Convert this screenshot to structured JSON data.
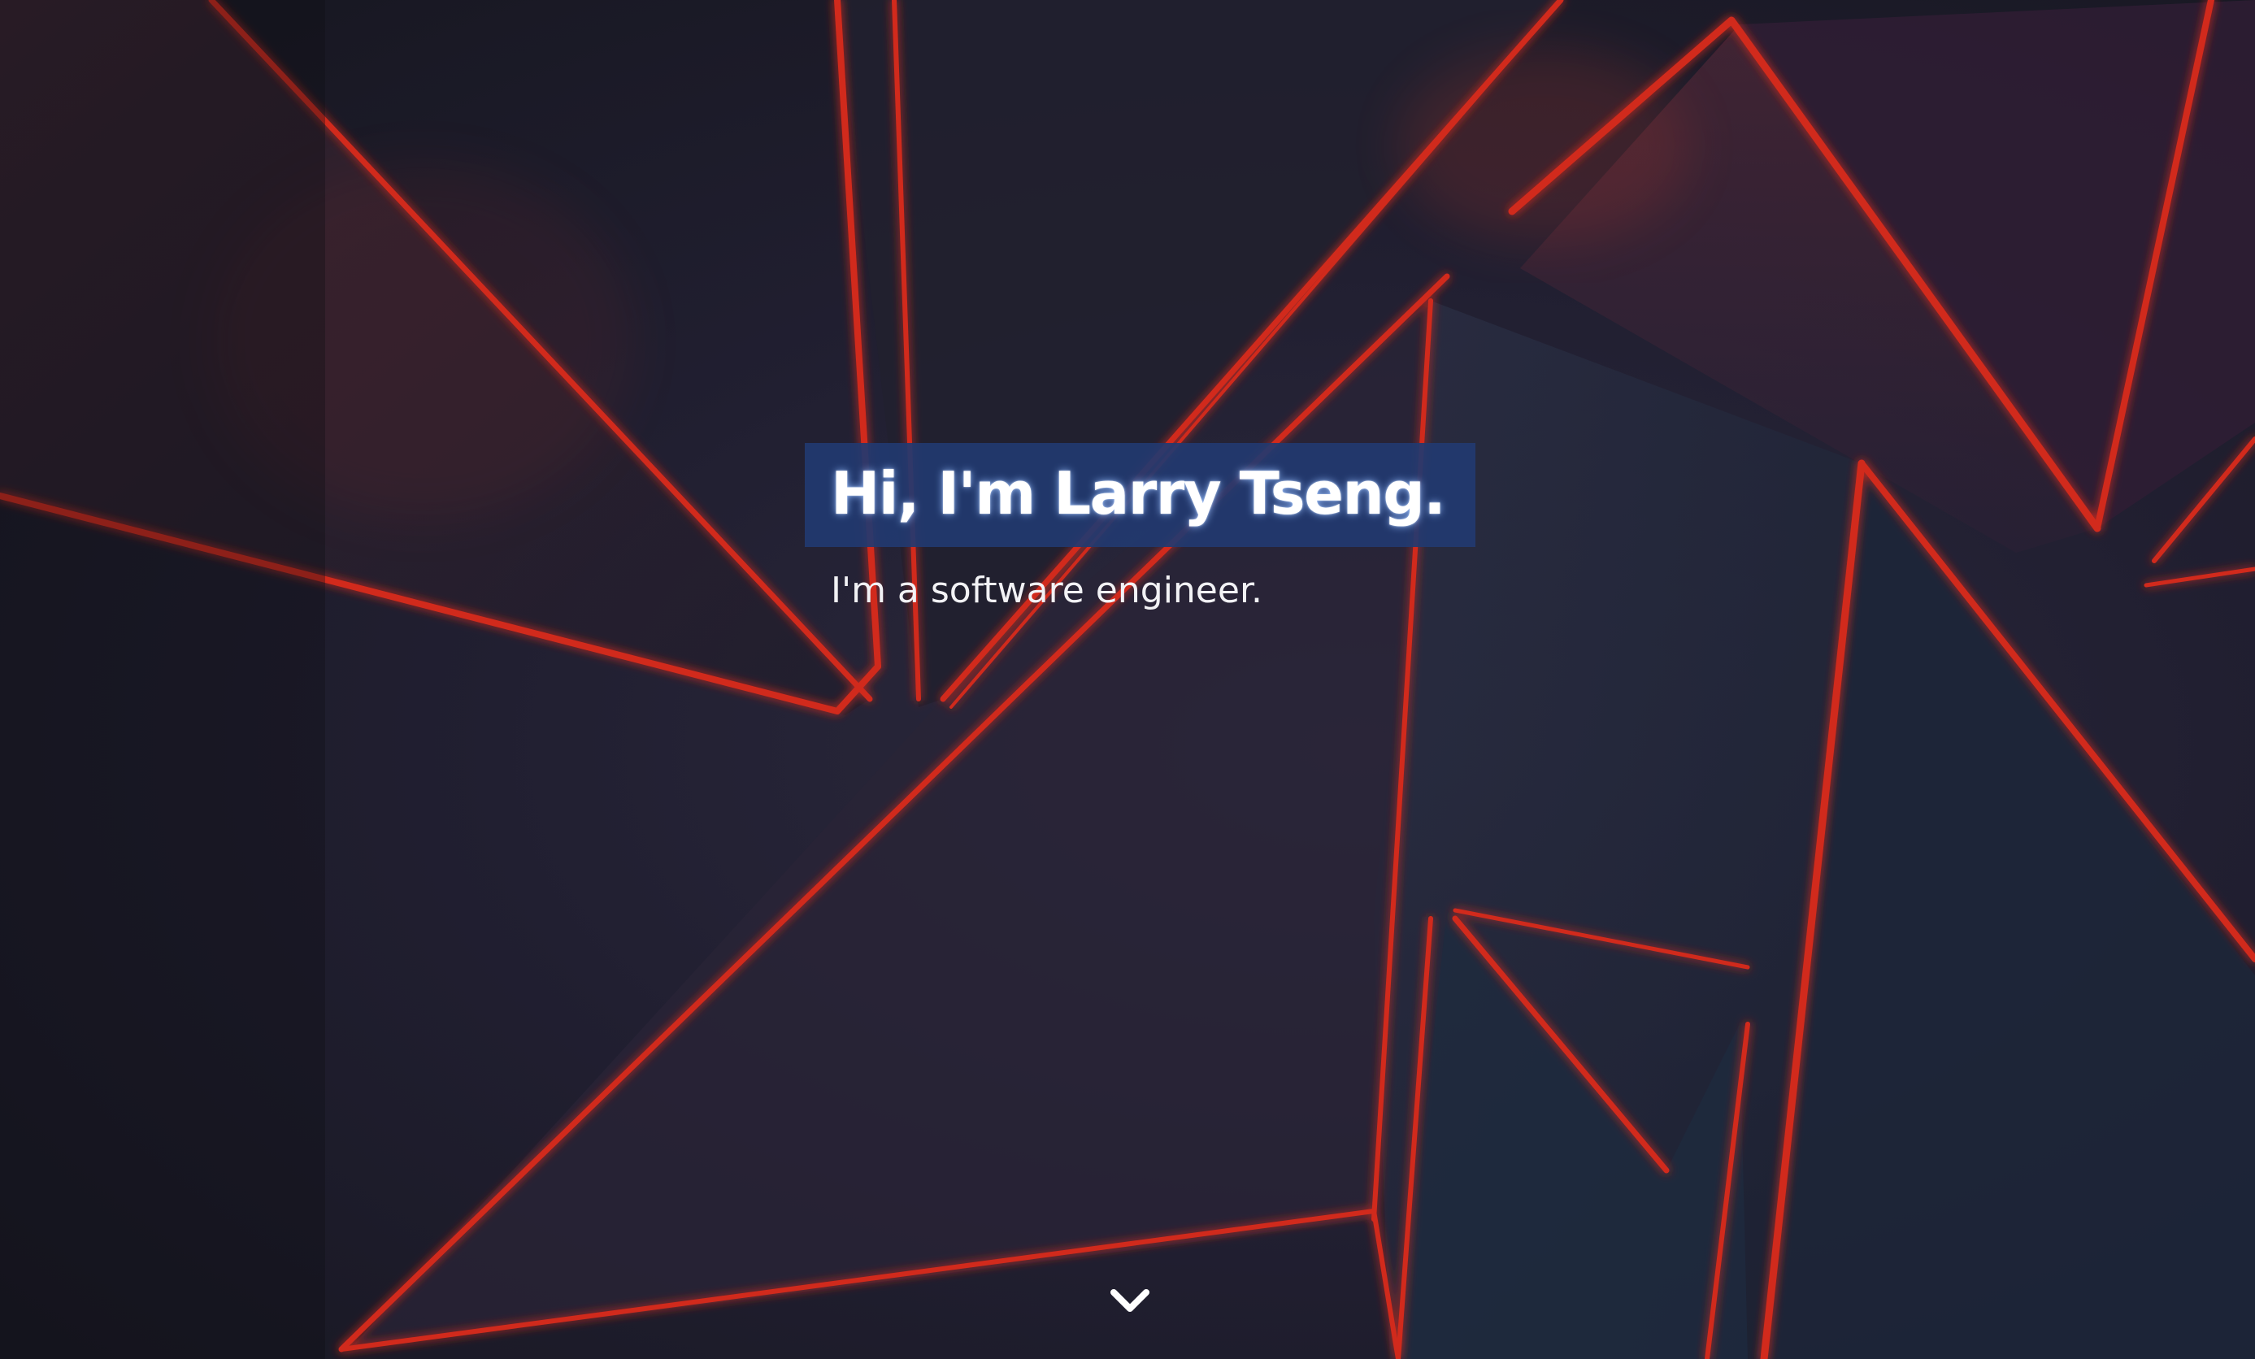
{
  "hero": {
    "title": "Hi, I'm Larry Tseng.",
    "subtitle": "I'm a software engineer."
  },
  "scroll_down": {
    "icon": "chevron-down-icon"
  },
  "colors": {
    "title_highlight": "#223a70",
    "accent_lines": "#d12a1c",
    "background": "#1e1d2d",
    "text": "#ffffff"
  }
}
